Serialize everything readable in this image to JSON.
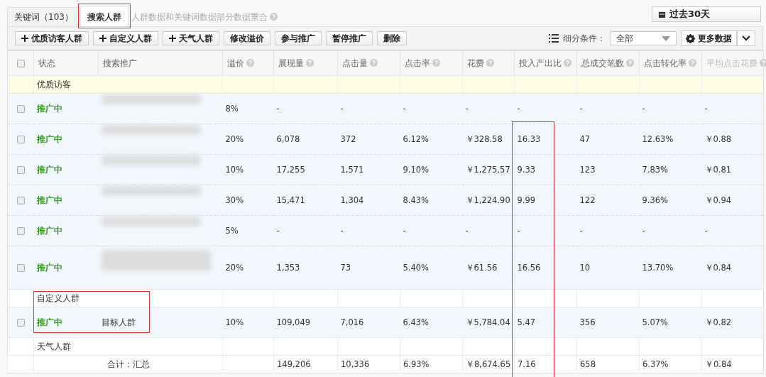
{
  "tabs": [
    {
      "label": "关键词",
      "count": "（103）",
      "selected": false,
      "highlighted": false
    },
    {
      "label": "搜索人群",
      "selected": true,
      "highlighted": true
    }
  ],
  "notice": "人群数据和关键词数据部分数据重合",
  "date_button": "过去30天",
  "toolbar": [
    {
      "label": "优质访客人群",
      "kind": "add"
    },
    {
      "label": "自定义人群",
      "kind": "add"
    },
    {
      "label": "天气人群",
      "kind": "add"
    },
    {
      "label": "修改溢价",
      "kind": "plain"
    },
    {
      "label": "参与推广",
      "kind": "plain"
    },
    {
      "label": "暂停推广",
      "kind": "plain"
    },
    {
      "label": "删除",
      "kind": "plain"
    }
  ],
  "filter": {
    "label": "细分条件：",
    "value": "全部"
  },
  "more_button": "更多数据",
  "select_all": {
    "checked": false
  },
  "columns": [
    {
      "label": "状态",
      "help": false,
      "highlighted": false
    },
    {
      "label": "搜索推广",
      "help": false,
      "highlighted": false
    },
    {
      "label": "溢价",
      "help": true,
      "highlighted": false
    },
    {
      "label": "展现量",
      "help": true,
      "highlighted": false
    },
    {
      "label": "点击量",
      "help": true,
      "highlighted": false
    },
    {
      "label": "点击率",
      "help": true,
      "highlighted": false
    },
    {
      "label": "花费",
      "help": true,
      "highlighted": false
    },
    {
      "label": "投入产出比",
      "help": true,
      "highlighted": true
    },
    {
      "label": "总成交笔数",
      "help": true,
      "highlighted": false
    },
    {
      "label": "点击转化率",
      "help": true,
      "highlighted": false
    },
    {
      "label": "平均点击花费",
      "help": true,
      "highlighted": false
    }
  ],
  "groups": [
    {
      "name": "优质访客",
      "highlighted": false,
      "rows": [
        {
          "checked": false,
          "status": "推广中",
          "name_blurred": true,
          "tall": false,
          "values": [
            "8%",
            "-",
            "-",
            "-",
            "-",
            "-",
            "-",
            "-",
            "-"
          ]
        },
        {
          "checked": false,
          "status": "推广中",
          "name_blurred": true,
          "tall": false,
          "values": [
            "20%",
            "6,078",
            "372",
            "6.12%",
            "￥328.58",
            "16.33",
            "47",
            "12.63%",
            "￥0.88"
          ]
        },
        {
          "checked": false,
          "status": "推广中",
          "name_blurred": true,
          "tall": false,
          "values": [
            "10%",
            "17,255",
            "1,571",
            "9.10%",
            "￥1,275.57",
            "9.33",
            "123",
            "7.83%",
            "￥0.81"
          ]
        },
        {
          "checked": false,
          "status": "推广中",
          "name_blurred": true,
          "tall": false,
          "values": [
            "30%",
            "15,471",
            "1,304",
            "8.43%",
            "￥1,224.90",
            "9.99",
            "122",
            "9.36%",
            "￥0.94"
          ]
        },
        {
          "checked": false,
          "status": "推广中",
          "name_blurred": true,
          "tall": false,
          "values": [
            "5%",
            "-",
            "-",
            "-",
            "-",
            "-",
            "-",
            "-",
            "-"
          ]
        },
        {
          "checked": false,
          "status": "推广中",
          "name_blurred": true,
          "tall": true,
          "values": [
            "20%",
            "1,353",
            "73",
            "5.40%",
            "￥61.56",
            "16.56",
            "10",
            "13.70%",
            "￥0.84"
          ]
        }
      ]
    },
    {
      "name": "自定义人群",
      "highlighted": true,
      "rows": [
        {
          "checked": false,
          "status": "推广中",
          "name": "目标人群",
          "tall": false,
          "values": [
            "10%",
            "109,049",
            "7,016",
            "6.43%",
            "￥5,784.04",
            "5.47",
            "356",
            "5.07%",
            "￥0.82"
          ]
        }
      ]
    },
    {
      "name": "天气人群",
      "highlighted": false
    }
  ],
  "total": {
    "label": "合计：汇总",
    "values": [
      "149,206",
      "10,336",
      "6.93%",
      "￥8,674.65",
      "7.16",
      "658",
      "6.37%",
      "￥0.84"
    ]
  }
}
